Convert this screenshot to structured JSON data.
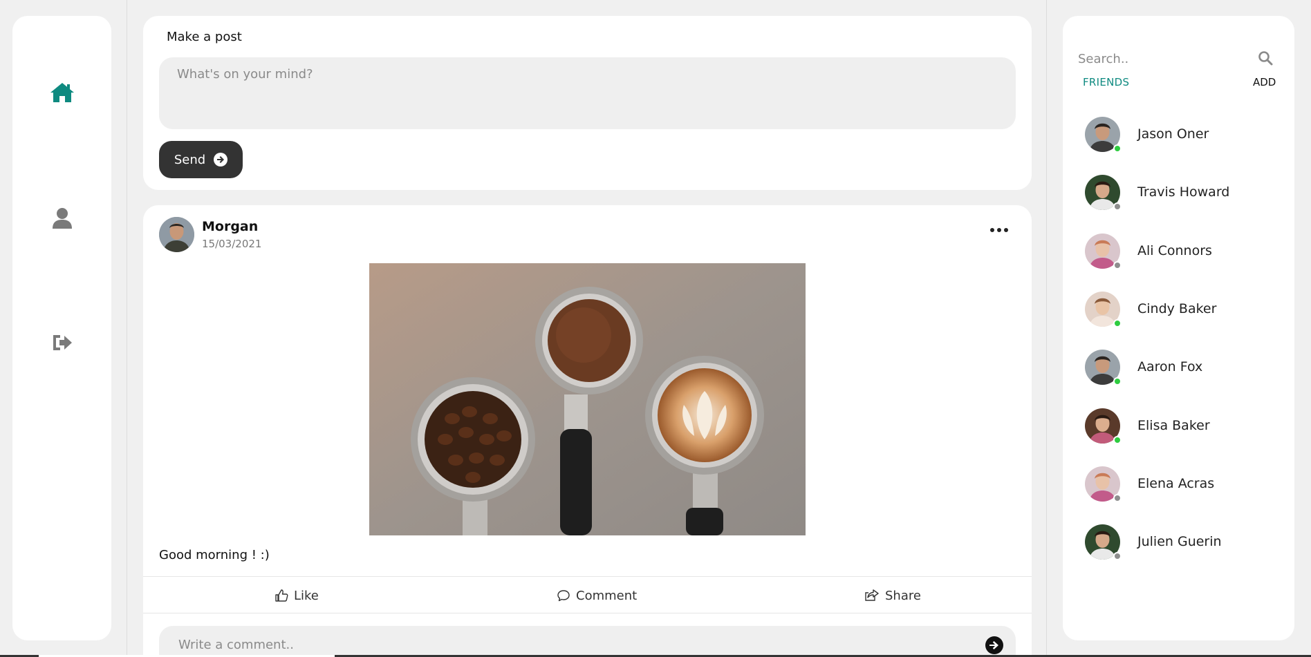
{
  "nav": {
    "items": [
      {
        "name": "home",
        "icon": "home-icon",
        "active": true
      },
      {
        "name": "profile",
        "icon": "user-icon",
        "active": false
      },
      {
        "name": "logout",
        "icon": "sign-out-icon",
        "active": false
      }
    ]
  },
  "composer": {
    "title": "Make a post",
    "placeholder": "What's on your mind?",
    "send_label": "Send"
  },
  "post": {
    "author": "Morgan",
    "date": "15/03/2021",
    "text": "Good morning ! :)",
    "actions": {
      "like": "Like",
      "comment": "Comment",
      "share": "Share"
    },
    "comment_placeholder": "Write a comment.."
  },
  "sidebar": {
    "search_placeholder": "Search..",
    "tabs": {
      "friends": "FRIENDS",
      "add": "ADD"
    },
    "friends": [
      {
        "name": "Jason Oner",
        "status": "online"
      },
      {
        "name": "Travis Howard",
        "status": "offline"
      },
      {
        "name": "Ali Connors",
        "status": "offline"
      },
      {
        "name": "Cindy Baker",
        "status": "online"
      },
      {
        "name": "Aaron Fox",
        "status": "online"
      },
      {
        "name": "Elisa Baker",
        "status": "online"
      },
      {
        "name": "Elena Acras",
        "status": "offline"
      },
      {
        "name": "Julien Guerin",
        "status": "offline"
      }
    ]
  },
  "colors": {
    "accent": "#0e8a80",
    "nav_inactive": "#7a7a7a",
    "online": "#2ecc40",
    "offline": "#8e8e8e",
    "dark_button": "#333333"
  }
}
